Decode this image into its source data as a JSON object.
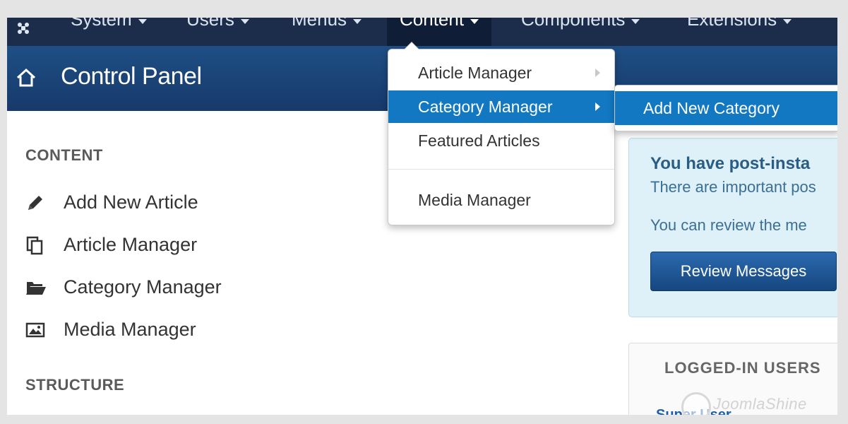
{
  "topnav": {
    "items": [
      {
        "label": "System"
      },
      {
        "label": "Users"
      },
      {
        "label": "Menus"
      },
      {
        "label": "Content"
      },
      {
        "label": "Components"
      },
      {
        "label": "Extensions"
      }
    ],
    "active": "Content"
  },
  "header": {
    "title": "Control Panel"
  },
  "sidebar": {
    "content_heading": "CONTENT",
    "items": [
      {
        "label": "Add New Article",
        "icon": "pencil-icon"
      },
      {
        "label": "Article Manager",
        "icon": "copy-icon"
      },
      {
        "label": "Category Manager",
        "icon": "folder-open-icon"
      },
      {
        "label": "Media Manager",
        "icon": "image-icon"
      }
    ],
    "structure_heading": "STRUCTURE"
  },
  "dropdown": {
    "items": [
      {
        "label": "Article Manager",
        "has_submenu": true
      },
      {
        "label": "Category Manager",
        "has_submenu": true,
        "active": true
      },
      {
        "label": "Featured Articles"
      },
      {
        "label": "Media Manager"
      }
    ],
    "submenu": {
      "items": [
        {
          "label": "Add New Category"
        }
      ]
    }
  },
  "alert": {
    "title": "You have post-insta",
    "line1": "There are important pos",
    "line2": "You can review the me",
    "button": "Review Messages"
  },
  "users_box": {
    "heading": "LOGGED-IN USERS",
    "user": "Super User"
  },
  "watermark": {
    "text": "JoomlaShine"
  },
  "colors": {
    "nav_bg": "#1b2d4b",
    "header_bg": "#1e4f85",
    "menu_active": "#1378c2",
    "alert_bg": "#def1f9",
    "button_bg": "#1d5a9a"
  }
}
